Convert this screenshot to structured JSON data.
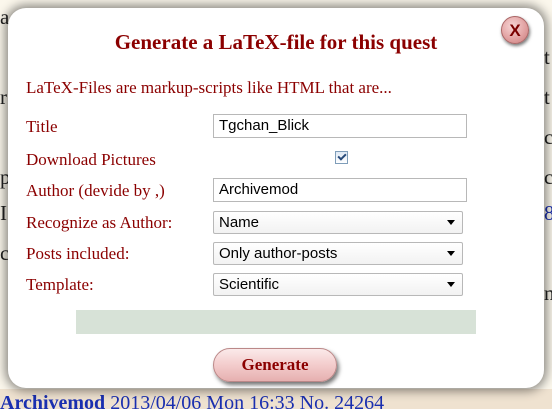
{
  "background": {
    "fragments": [
      {
        "text": "a",
        "color": "#222222"
      },
      {
        "text": "t",
        "color": "#222222"
      },
      {
        "text": "t",
        "color": "#222222"
      },
      {
        "text": "r",
        "color": "#222222"
      },
      {
        "text": "c",
        "color": "#222222"
      },
      {
        "text": "p",
        "color": "#222222"
      },
      {
        "text": "c",
        "color": "#222222"
      },
      {
        "text": "I",
        "color": "#222222"
      },
      {
        "text": "8",
        "color": "#1a2fb0"
      },
      {
        "text": "c",
        "color": "#222222"
      },
      {
        "text": "n",
        "color": "#222222"
      }
    ],
    "bottom_author": "Archivemod",
    "bottom_rest": " 2013/04/06 Mon 16:33 No. 24264"
  },
  "dialog": {
    "title": "Generate a LaTeX-file for this quest",
    "close_label": "X",
    "intro": "LaTeX-Files are markup-scripts like HTML that are...",
    "fields": {
      "title_label": "Title",
      "title_value": "Tgchan_Blick",
      "download_pictures_label": "Download Pictures",
      "download_pictures_checked": true,
      "author_label": "Author (devide by ,)",
      "author_value": "Archivemod",
      "recognize_label": "Recognize as Author:",
      "recognize_value": "Name",
      "posts_label": "Posts included:",
      "posts_value": "Only author-posts",
      "template_label": "Template:",
      "template_value": "Scientific"
    },
    "generate_label": "Generate"
  },
  "colors": {
    "accent": "#8b0000",
    "status_bar": "#d7e2d7",
    "link": "#1a2fb0"
  }
}
